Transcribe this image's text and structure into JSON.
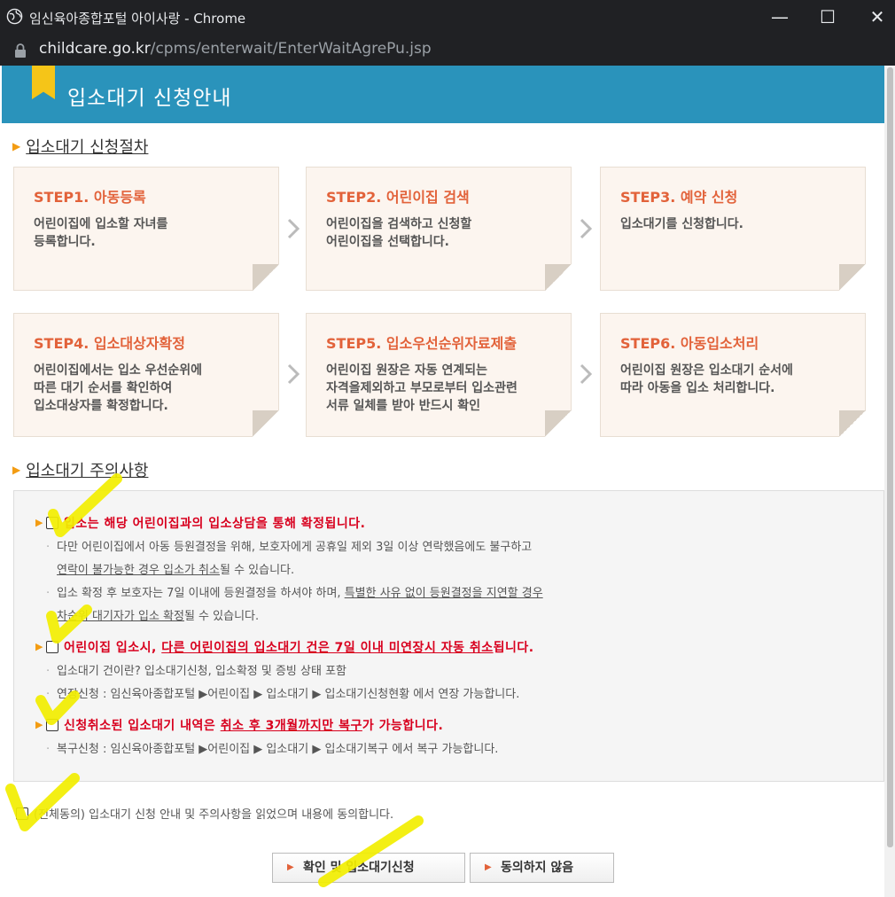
{
  "window": {
    "title": "임신육아종합포털 아이사랑 - Chrome",
    "url_host": "childcare.go.kr",
    "url_path": "/cpms/enterwait/EnterWaitAgrePu.jsp",
    "minimize": "—",
    "maximize": "☐",
    "close": "✕"
  },
  "header": {
    "title": "입소대기 신청안내"
  },
  "procedure": {
    "title": "입소대기 신청절차",
    "steps": [
      {
        "title": "STEP1. 아동등록",
        "desc": "어린이집에 입소할 자녀를\n등록합니다."
      },
      {
        "title": "STEP2. 어린이집 검색",
        "desc": "어린이집을 검색하고 신청할\n어린이집을 선택합니다."
      },
      {
        "title": "STEP3. 예약 신청",
        "desc": "입소대기를 신청합니다."
      },
      {
        "title": "STEP4. 입소대상자확정",
        "desc": "어린이집에서는 입소 우선순위에\n따른 대기 순서를 확인하여\n입소대상자를 확정합니다."
      },
      {
        "title": "STEP5. 입소우선순위자료제출",
        "desc": "어린이집 원장은 자동 연계되는\n자격을제외하고 부모로부터 입소관련\n서류 일체를 받아 반드시 확인"
      },
      {
        "title": "STEP6. 아동입소처리",
        "desc": "어린이집 원장은 입소대기 순서에\n따라 아동을 입소 처리합니다."
      }
    ]
  },
  "notice": {
    "title": "입소대기 주의사항",
    "item1": {
      "heading": "입소는 해당 어린이집과의 입소상담을 통해 확정됩니다.",
      "line1": "다만 어린이집에서 아동 등원결정을 위해, 보호자에게 공휴일 제외 3일 이상 연락했음에도 불구하고",
      "line2_u": "연락이 불가능한 경우 입소가 취소",
      "line2_rest": "될 수 있습니다.",
      "line3_a": "입소 확정 후 보호자는 7일 이내에 등원결정을 하셔야 하며, ",
      "line3_u": "특별한 사유 없이 등원결정을 지연할 경우",
      "line4_u": "차순위 대기자가 입소 확정",
      "line4_rest": "될 수 있습니다."
    },
    "item2": {
      "heading_a": "어린이집 입소시, ",
      "heading_u": "다른 어린이집의 입소대기 건은 7일 이내 미연장시 자동 취소",
      "heading_b": "됩니다.",
      "line1": "입소대기 건이란? 입소대기신청, 입소확정 및 증빙 상태 포함",
      "line2": "연장신청 : 임신육아종합포털 ▶어린이집 ▶ 입소대기 ▶ 입소대기신청현황 에서 연장 가능합니다."
    },
    "item3": {
      "heading_a": "신청취소된 입소대기 내역은 ",
      "heading_u": "취소 후 3개월까지만 복구",
      "heading_b": "가 가능합니다.",
      "line1": "복구신청 : 임신육아종합포털 ▶어린이집 ▶ 입소대기 ▶ 입소대기복구 에서 복구 가능합니다."
    }
  },
  "agree_all": "(전체동의) 입소대기 신청 안내 및 주의사항을 읽었으며 내용에 동의합니다.",
  "buttons": {
    "confirm": "확인 및 입소대기신청",
    "disagree": "동의하지 않음"
  }
}
